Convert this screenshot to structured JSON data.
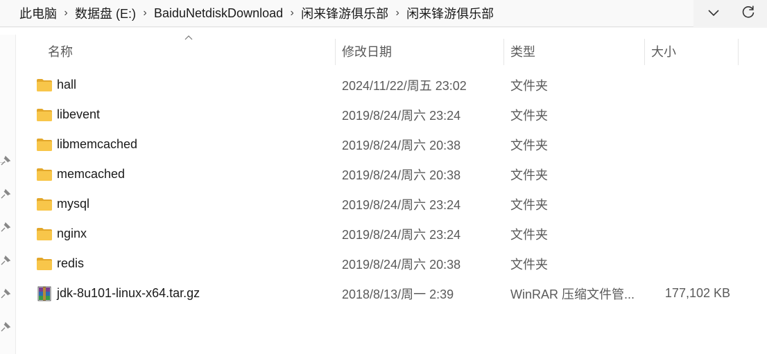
{
  "breadcrumb": {
    "items": [
      "此电脑",
      "数据盘 (E:)",
      "BaiduNetdiskDownload",
      "闲来锋游俱乐部",
      "闲来锋游俱乐部"
    ]
  },
  "icons": {
    "dropdown": "chevron-down-icon",
    "refresh": "refresh-icon",
    "folder": "folder-icon",
    "archive": "winrar-archive-icon",
    "pin": "pin-icon",
    "sort": "sort-up-arrow-icon"
  },
  "colors": {
    "folder": "#f8c64a",
    "folder_dark": "#e3a72a",
    "header_text": "#5a5a5a"
  },
  "columns": {
    "name": "名称",
    "date": "修改日期",
    "type": "类型",
    "size": "大小"
  },
  "files": [
    {
      "name": "hall",
      "date": "2024/11/22/周五 23:02",
      "type": "文件夹",
      "size": "",
      "icon": "folder"
    },
    {
      "name": "libevent",
      "date": "2019/8/24/周六 23:24",
      "type": "文件夹",
      "size": "",
      "icon": "folder"
    },
    {
      "name": "libmemcached",
      "date": "2019/8/24/周六 20:38",
      "type": "文件夹",
      "size": "",
      "icon": "folder"
    },
    {
      "name": "memcached",
      "date": "2019/8/24/周六 20:38",
      "type": "文件夹",
      "size": "",
      "icon": "folder"
    },
    {
      "name": "mysql",
      "date": "2019/8/24/周六 23:24",
      "type": "文件夹",
      "size": "",
      "icon": "folder"
    },
    {
      "name": "nginx",
      "date": "2019/8/24/周六 23:24",
      "type": "文件夹",
      "size": "",
      "icon": "folder"
    },
    {
      "name": "redis",
      "date": "2019/8/24/周六 20:38",
      "type": "文件夹",
      "size": "",
      "icon": "folder"
    },
    {
      "name": "jdk-8u101-linux-x64.tar.gz",
      "date": "2018/8/13/周一 2:39",
      "type": "WinRAR 压缩文件管...",
      "size": "177,102 KB",
      "icon": "archive"
    }
  ]
}
